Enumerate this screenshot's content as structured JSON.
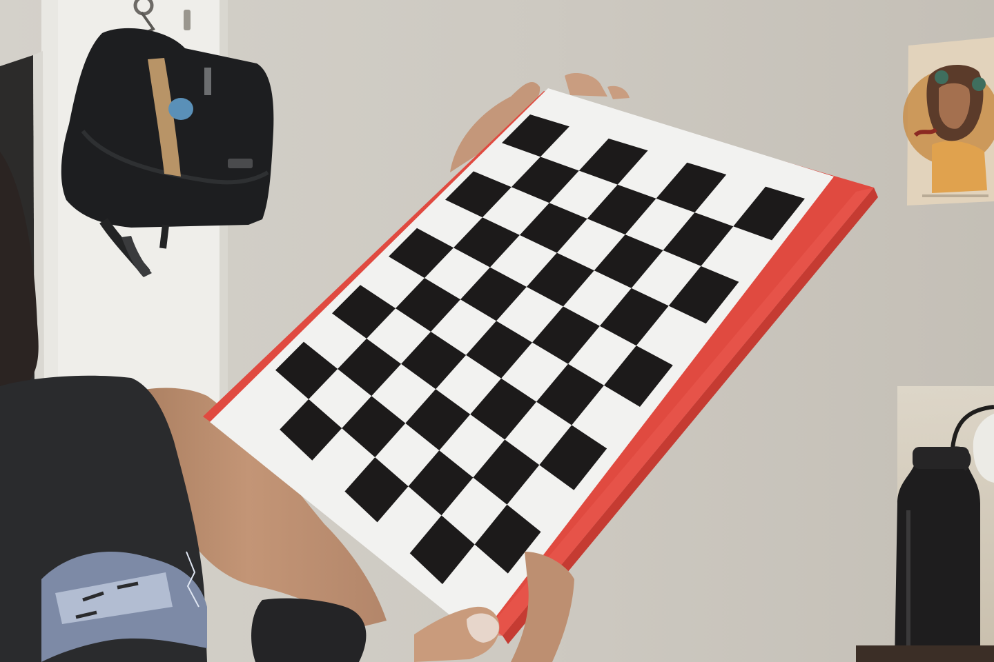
{
  "colors": {
    "wall": "#cfcbc3",
    "door": "#ecebe6",
    "clipboard": "#e04a40",
    "paper": "#f2f2f0",
    "square": "#1c1a1a",
    "shirt": "#2a2b2d",
    "skin": "#c89b7b",
    "bottle": "#1e1d1e"
  },
  "checkerboard": {
    "rows": 7,
    "columns": 10
  }
}
